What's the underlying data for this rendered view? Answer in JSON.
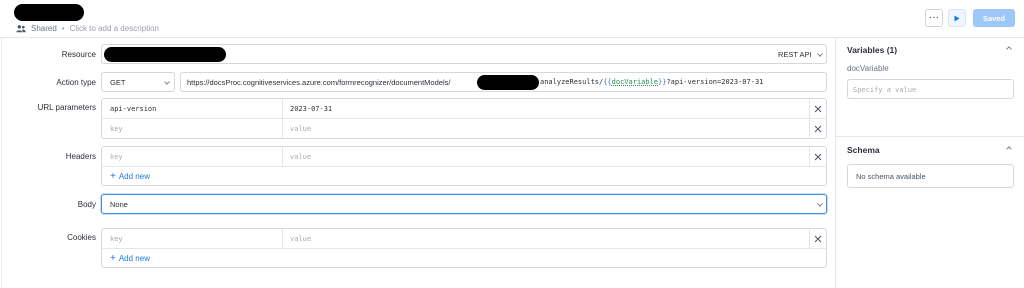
{
  "header": {
    "shared_label": "Shared",
    "separator": "•",
    "description_placeholder": "Click to add a description",
    "more_label": "···",
    "saved_label": "Saved"
  },
  "form": {
    "resource": {
      "label": "Resource",
      "type": "REST API"
    },
    "action_type": {
      "label": "Action type",
      "method": "GET",
      "url_prefix": "https://docsProc.cognitiveservices.azure.com/formrecognizer/documentModels/",
      "url_mid": "analyzeResults/",
      "url_open": "{{",
      "url_var": "docVariable",
      "url_close": "}}",
      "url_suffix": "?api-version=2023-07-31"
    },
    "url_parameters": {
      "label": "URL parameters",
      "rows": [
        {
          "key": "api-version",
          "value": "2023-07-31"
        },
        {
          "key": "",
          "value": ""
        }
      ],
      "key_placeholder": "key",
      "value_placeholder": "value"
    },
    "headers": {
      "label": "Headers",
      "key_placeholder": "key",
      "value_placeholder": "value",
      "add_label": "Add new"
    },
    "body": {
      "label": "Body",
      "value": "None"
    },
    "cookies": {
      "label": "Cookies",
      "key_placeholder": "key",
      "value_placeholder": "value",
      "add_label": "Add new"
    }
  },
  "right_panel": {
    "variables_title": "Variables (1)",
    "variable_name": "docVariable",
    "variable_placeholder": "Specify a value",
    "schema_title": "Schema",
    "schema_empty": "No schema available"
  },
  "colors": {
    "accent": "#1f7ad6",
    "saved_button": "#9cc7f7",
    "focus_border": "#3f8ee8",
    "variable_green": "#2e8b57"
  },
  "icons": [
    "people-icon",
    "more-icon",
    "play-icon",
    "chevron-down-icon",
    "close-icon",
    "plus-icon",
    "chevron-up-icon"
  ]
}
